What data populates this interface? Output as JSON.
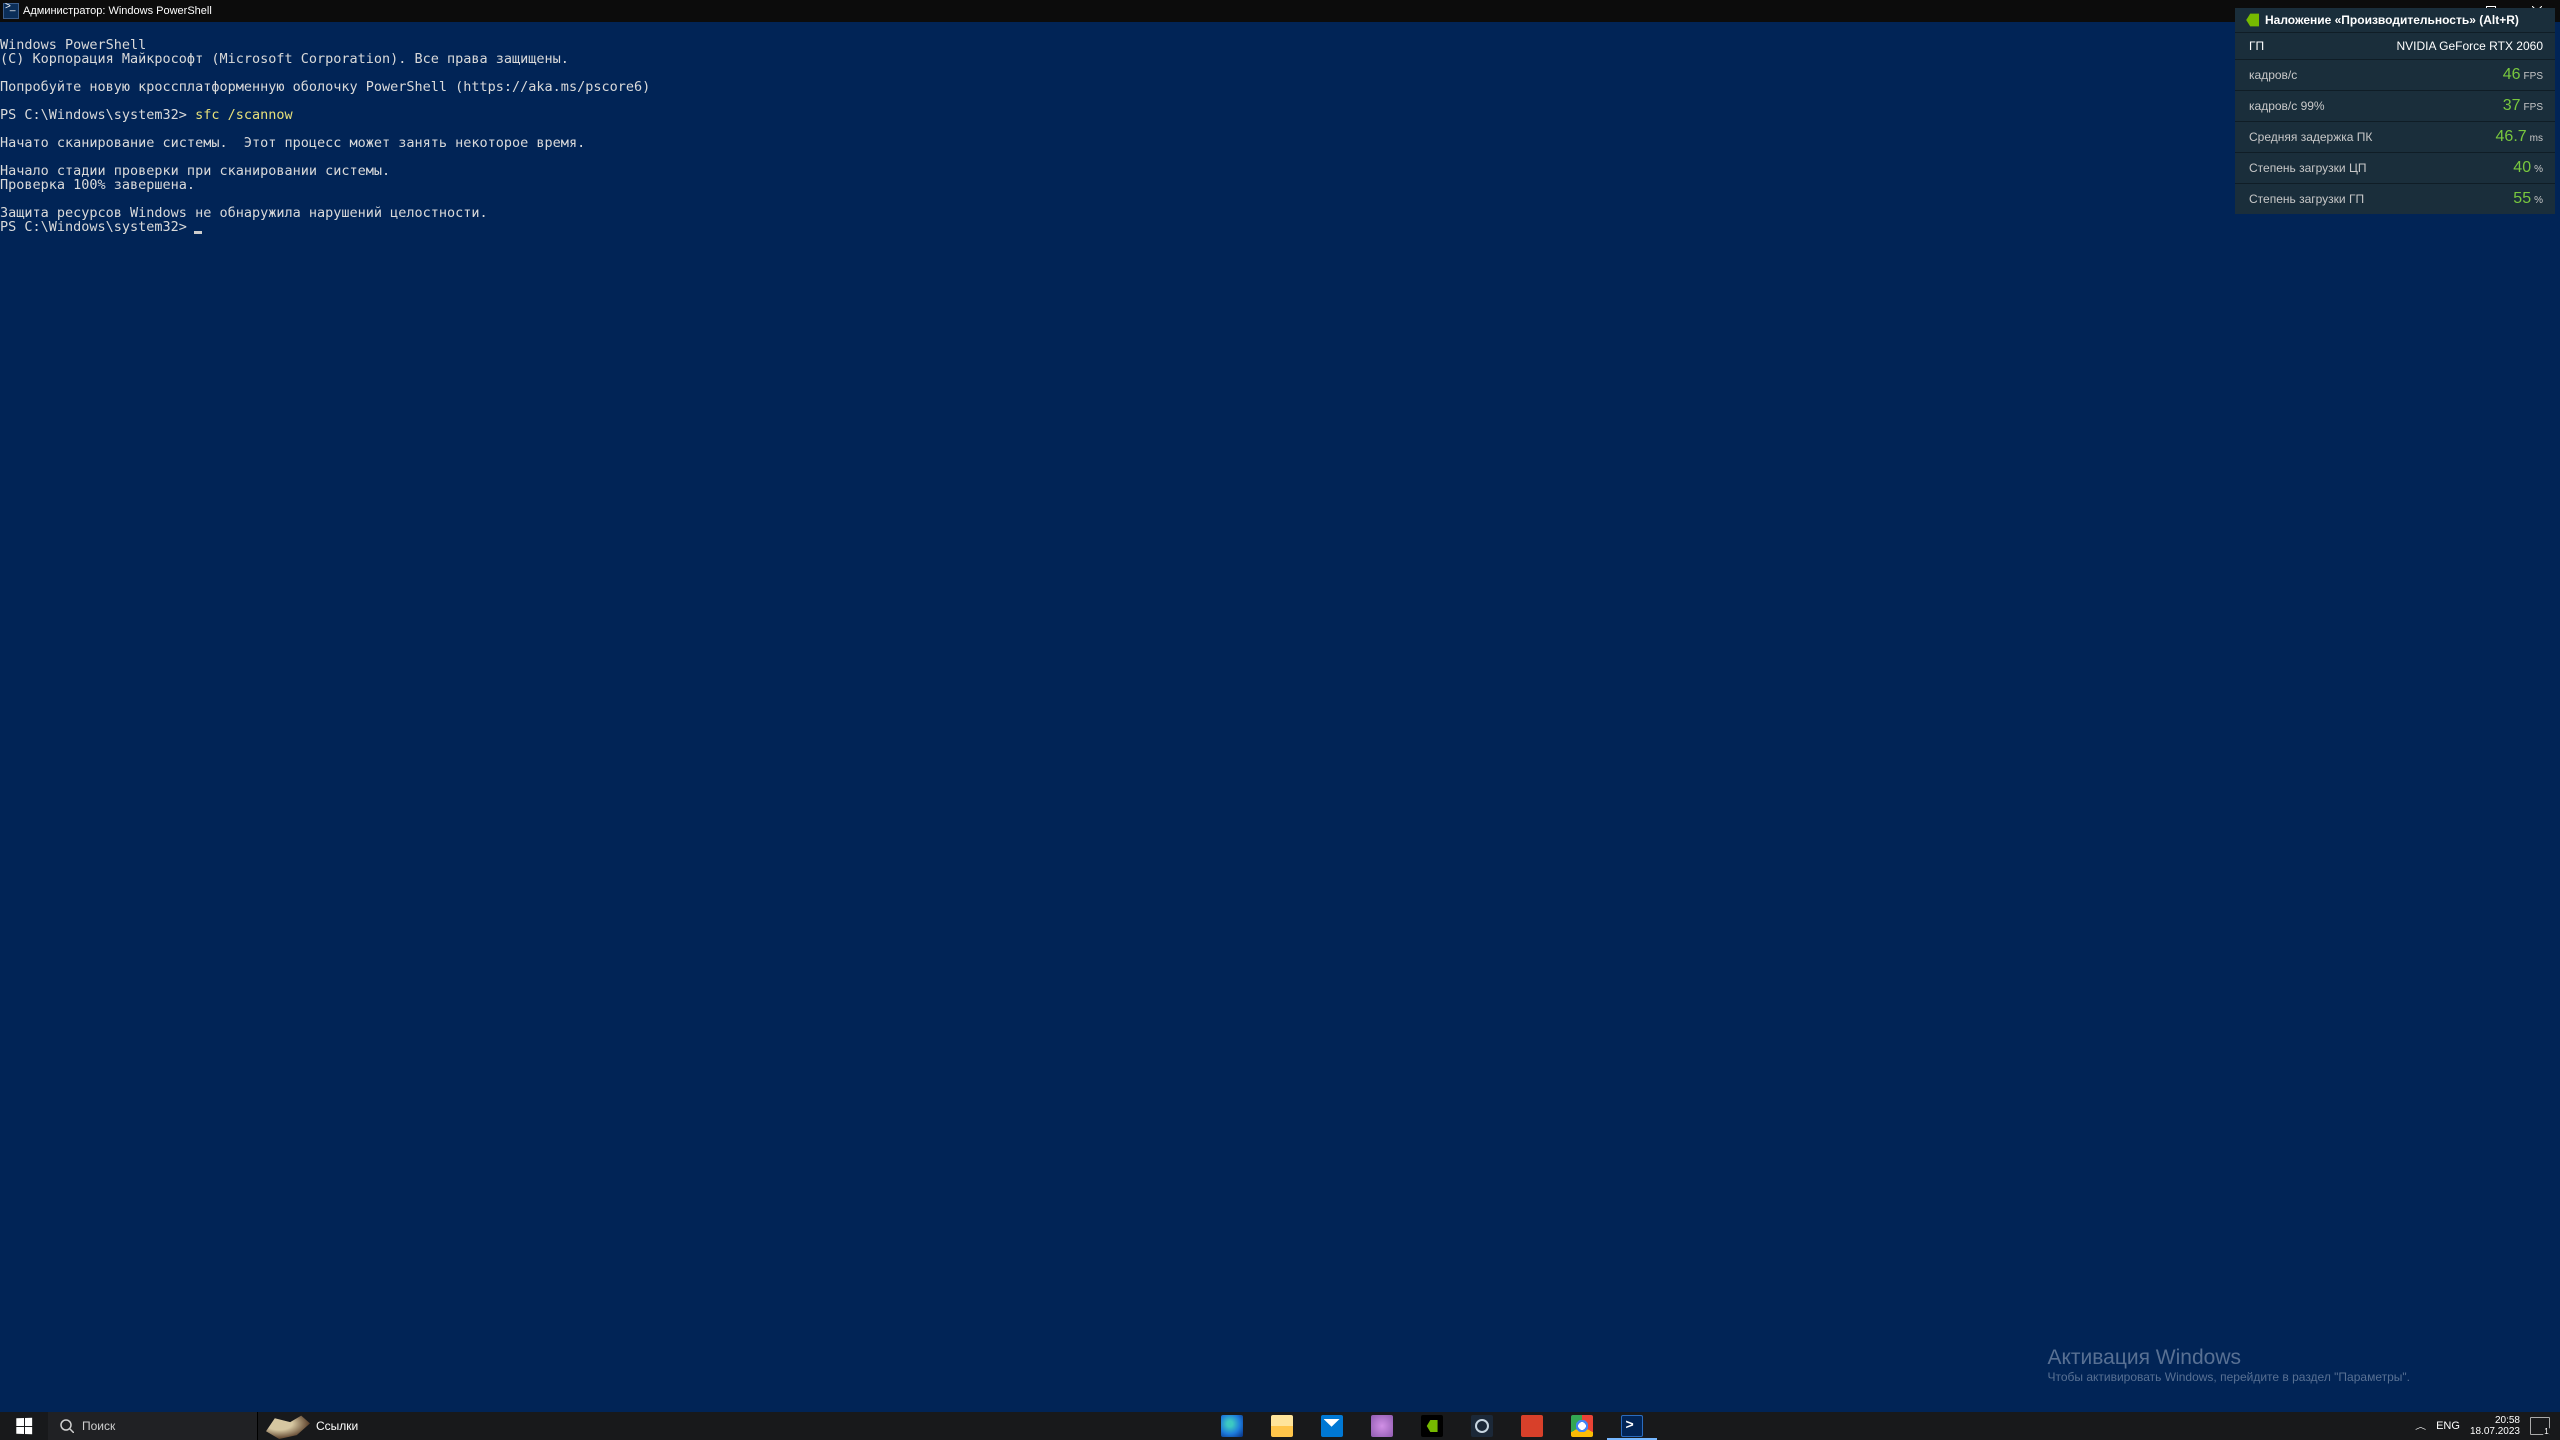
{
  "titlebar": {
    "title": "Администратор: Windows PowerShell"
  },
  "terminal": {
    "header1": "Windows PowerShell",
    "header2": "(C) Корпорация Майкрософт (Microsoft Corporation). Все права защищены.",
    "tip": "Попробуйте новую кроссплатформенную оболочку PowerShell (https://aka.ms/pscore6)",
    "prompt1": "PS C:\\Windows\\system32>",
    "cmd1": "sfc /scannow",
    "line1": "Начато сканирование системы.  Этот процесс может занять некоторое время.",
    "line2": "Начало стадии проверки при сканировании системы.",
    "line3": "Проверка 100% завершена.",
    "line4": "Защита ресурсов Windows не обнаружила нарушений целостности.",
    "prompt2": "PS C:\\Windows\\system32>"
  },
  "overlay": {
    "title": "Наложение «Производительность» (Alt+R)",
    "gpu_label": "ГП",
    "gpu_name": "NVIDIA GeForce RTX 2060",
    "rows": [
      {
        "label": "кадров/с",
        "value": "46",
        "unit": "FPS"
      },
      {
        "label": "кадров/с 99%",
        "value": "37",
        "unit": "FPS"
      },
      {
        "label": "Средняя задержка ПК",
        "value": "46.7",
        "unit": "ms"
      },
      {
        "label": "Степень загрузки ЦП",
        "value": "40",
        "unit": "%"
      },
      {
        "label": "Степень загрузки ГП",
        "value": "55",
        "unit": "%"
      }
    ]
  },
  "watermark": {
    "heading": "Активация Windows",
    "sub": "Чтобы активировать Windows, перейдите в раздел \"Параметры\"."
  },
  "taskbar": {
    "search_placeholder": "Поиск",
    "links_label": "Ссылки",
    "lang": "ENG",
    "time": "20:58",
    "date": "18.07.2023"
  }
}
